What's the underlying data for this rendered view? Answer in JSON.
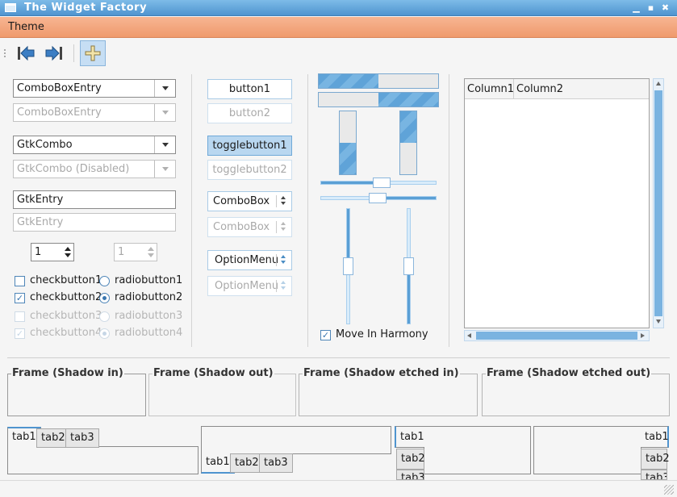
{
  "window": {
    "title": "The Widget Factory"
  },
  "menubar": {
    "items": [
      "Theme"
    ]
  },
  "toolbar": {
    "icons": [
      "go-first-icon",
      "go-last-icon",
      "add-icon"
    ],
    "accent": "#4f94cf"
  },
  "left_column": {
    "combo_entry": "ComboBoxEntry",
    "combo_entry_disabled": "ComboBoxEntry",
    "gtk_combo": "GtkCombo",
    "gtk_combo_disabled": "GtkCombo (Disabled)",
    "entry": "GtkEntry",
    "entry_disabled": "GtkEntry",
    "spin_value": "1",
    "spin_disabled_value": "1",
    "checkbuttons": [
      "checkbutton1",
      "checkbutton2",
      "checkbutton3",
      "checkbutton4"
    ],
    "radiobuttons": [
      "radiobutton1",
      "radiobutton2",
      "radiobutton3",
      "radiobutton4"
    ]
  },
  "middle_column": {
    "button1": "button1",
    "button2": "button2",
    "togglebutton1": "togglebutton1",
    "togglebutton2": "togglebutton2",
    "combobox": "ComboBox",
    "combobox_disabled": "ComboBox",
    "optionmenu": "OptionMenu",
    "optionmenu_disabled": "OptionMenu"
  },
  "scales": {
    "harmony_label": "Move In Harmony",
    "harmony_checked": true
  },
  "tree": {
    "columns": [
      "Column1",
      "Column2"
    ]
  },
  "frames": [
    "Frame (Shadow in)",
    "Frame (Shadow out)",
    "Frame (Shadow etched in)",
    "Frame (Shadow etched out)"
  ],
  "notebooks": {
    "tabs": [
      "tab1",
      "tab2",
      "tab3"
    ]
  }
}
